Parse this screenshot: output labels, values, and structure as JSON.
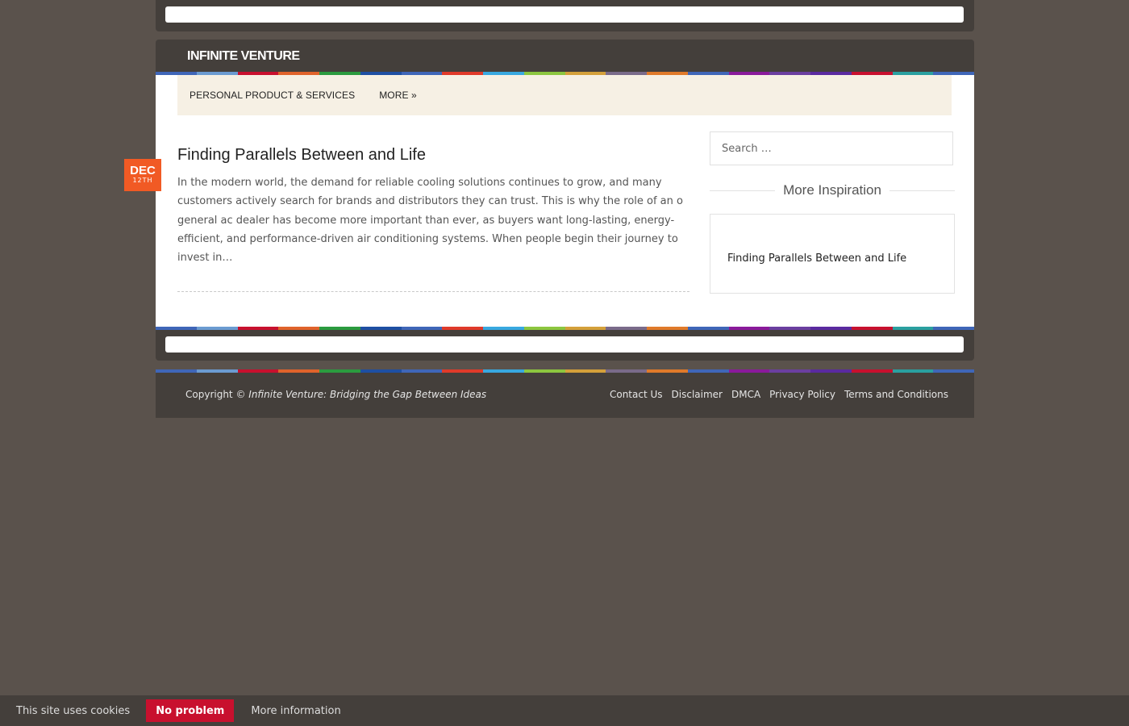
{
  "site": {
    "name": "INFINITE VENTURE",
    "stripe_colors": [
      "#3f66b8",
      "#6b9bd1",
      "#c8102e",
      "#e0632b",
      "#2b9b3f",
      "#1e4fa3",
      "#3f66b8",
      "#e03a2a",
      "#38a8e0",
      "#8cc63f",
      "#d4a03a",
      "#7a6b8a",
      "#e07a2a",
      "#3f66b8",
      "#8a1a9b",
      "#6b3fa0",
      "#5a2aa0",
      "#c8102e",
      "#2aa0a0",
      "#3f66b8"
    ]
  },
  "nav": {
    "items": [
      {
        "label": "PERSONAL PRODUCT & SERVICES"
      },
      {
        "label": "MORE »"
      }
    ]
  },
  "post": {
    "date_month": "DEC",
    "date_day": "12TH",
    "title": "Finding Parallels Between and Life",
    "excerpt": "In the modern world, the demand for reliable cooling solutions continues to grow, and many customers actively search for brands and distributors they can trust. This is why the role of an o general ac dealer has become more important than ever, as buyers want long-lasting, energy-efficient, and performance-driven air conditioning systems. When people begin their journey to invest in…"
  },
  "sidebar": {
    "search_placeholder": "Search …",
    "widget_title": "More Inspiration",
    "links": [
      {
        "label": "Finding Parallels Between and Life"
      }
    ]
  },
  "footer": {
    "copyright_prefix": "Copyright ©",
    "copyright_site": "Infinite Venture: Bridging the Gap Between Ideas",
    "links": [
      {
        "label": "Contact Us"
      },
      {
        "label": "Disclaimer"
      },
      {
        "label": "DMCA"
      },
      {
        "label": "Privacy Policy"
      },
      {
        "label": "Terms and Conditions"
      }
    ]
  },
  "cookie": {
    "message": "This site uses cookies",
    "accept_label": "No problem",
    "more_label": "More information",
    "accent": "#c8102e"
  }
}
